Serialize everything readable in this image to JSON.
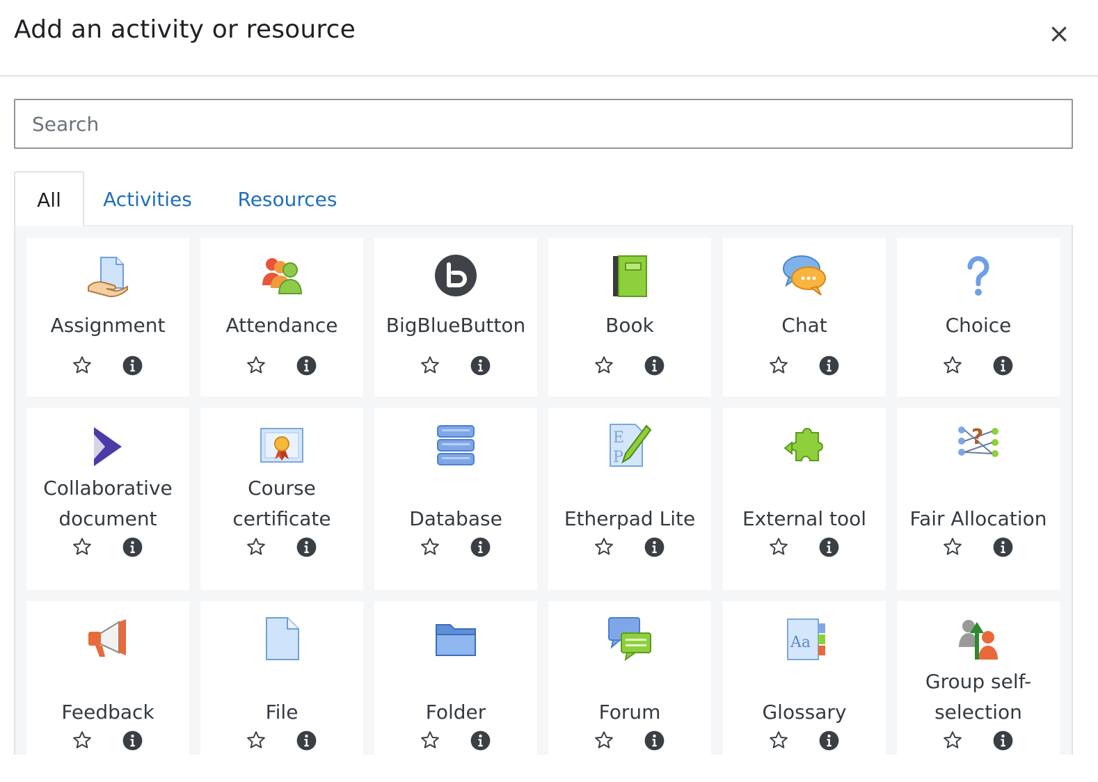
{
  "modal": {
    "title": "Add an activity or resource",
    "close": "×"
  },
  "search": {
    "placeholder": "Search",
    "value": ""
  },
  "tabs": [
    {
      "label": "All",
      "active": true
    },
    {
      "label": "Activities",
      "active": false
    },
    {
      "label": "Resources",
      "active": false
    }
  ],
  "colors": {
    "link": "#1f6fba",
    "panel_bg": "#f5f6f8",
    "text": "#343a40"
  },
  "items": [
    {
      "label": "Assignment",
      "icon": "assignment-icon"
    },
    {
      "label": "Attendance",
      "icon": "attendance-icon"
    },
    {
      "label": "BigBlueButton",
      "icon": "bigbluebutton-icon"
    },
    {
      "label": "Book",
      "icon": "book-icon"
    },
    {
      "label": "Chat",
      "icon": "chat-icon"
    },
    {
      "label": "Choice",
      "icon": "choice-icon"
    },
    {
      "label_lines": [
        "Collaborative",
        "document"
      ],
      "icon": "collaborative-document-icon"
    },
    {
      "label_lines": [
        "Course",
        "certificate"
      ],
      "icon": "course-certificate-icon"
    },
    {
      "label": "Database",
      "icon": "database-icon"
    },
    {
      "label": "Etherpad Lite",
      "icon": "etherpad-lite-icon"
    },
    {
      "label": "External tool",
      "icon": "external-tool-icon"
    },
    {
      "label": "Fair Allocation",
      "icon": "fair-allocation-icon"
    },
    {
      "label": "Feedback",
      "icon": "feedback-icon"
    },
    {
      "label": "File",
      "icon": "file-icon"
    },
    {
      "label": "Folder",
      "icon": "folder-icon"
    },
    {
      "label": "Forum",
      "icon": "forum-icon"
    },
    {
      "label": "Glossary",
      "icon": "glossary-icon"
    },
    {
      "label_lines": [
        "Group self-",
        "selection"
      ],
      "icon": "group-self-selection-icon"
    }
  ]
}
